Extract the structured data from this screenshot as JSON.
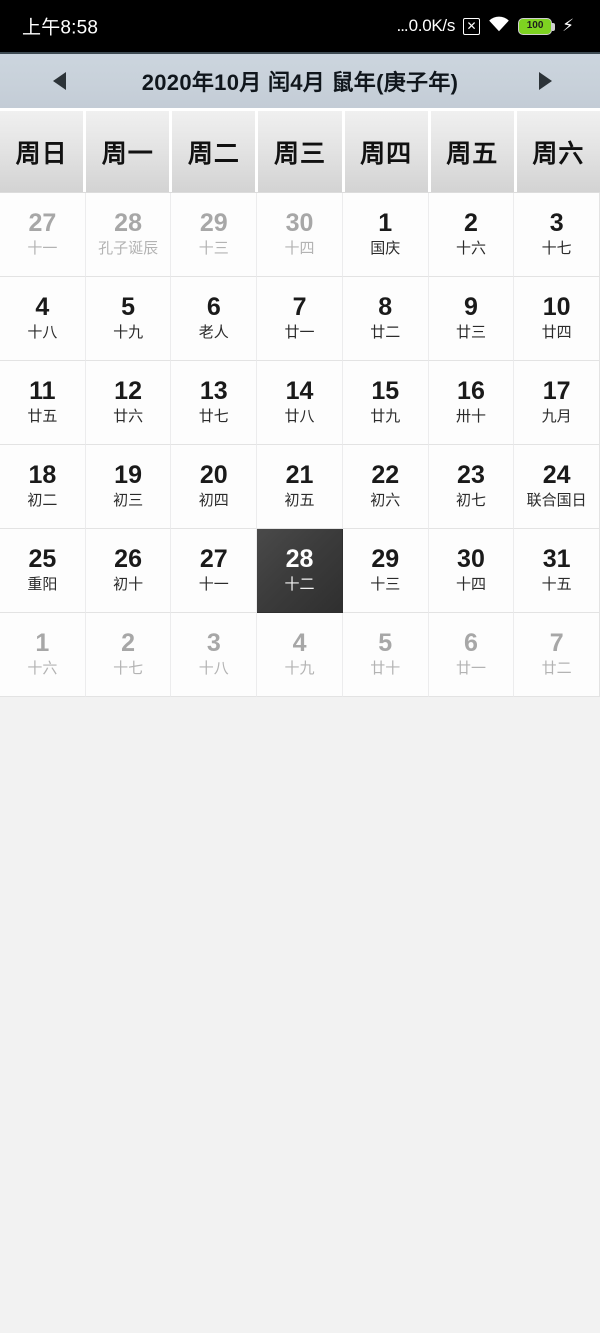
{
  "status_bar": {
    "clock": "上午8:58",
    "net_dots": "...",
    "net_speed": "0.0K/s",
    "nosim_glyph": "✕",
    "nosim_icon_name": "no-sim-icon",
    "wifi_icon_name": "wifi-icon",
    "battery_level": "100",
    "battery_color": "#7ed321",
    "charging_glyph": "⚡"
  },
  "titlebar": {
    "title": "2020年10月 闰4月 鼠年(庚子年)",
    "prev_label": "◀",
    "next_label": "▶"
  },
  "weekdays": [
    {
      "label": "周日"
    },
    {
      "label": "周一"
    },
    {
      "label": "周二"
    },
    {
      "label": "周三"
    },
    {
      "label": "周四"
    },
    {
      "label": "周五"
    },
    {
      "label": "周六"
    }
  ],
  "selected_color": "#3a3a3a",
  "weeks": [
    [
      {
        "day": "27",
        "lunar": "十一",
        "other": true,
        "selected": false
      },
      {
        "day": "28",
        "lunar": "孔子诞辰",
        "other": true,
        "selected": false
      },
      {
        "day": "29",
        "lunar": "十三",
        "other": true,
        "selected": false
      },
      {
        "day": "30",
        "lunar": "十四",
        "other": true,
        "selected": false
      },
      {
        "day": "1",
        "lunar": "国庆",
        "other": false,
        "selected": false
      },
      {
        "day": "2",
        "lunar": "十六",
        "other": false,
        "selected": false
      },
      {
        "day": "3",
        "lunar": "十七",
        "other": false,
        "selected": false
      }
    ],
    [
      {
        "day": "4",
        "lunar": "十八",
        "other": false,
        "selected": false
      },
      {
        "day": "5",
        "lunar": "十九",
        "other": false,
        "selected": false
      },
      {
        "day": "6",
        "lunar": "老人",
        "other": false,
        "selected": false
      },
      {
        "day": "7",
        "lunar": "廿一",
        "other": false,
        "selected": false
      },
      {
        "day": "8",
        "lunar": "廿二",
        "other": false,
        "selected": false
      },
      {
        "day": "9",
        "lunar": "廿三",
        "other": false,
        "selected": false
      },
      {
        "day": "10",
        "lunar": "廿四",
        "other": false,
        "selected": false
      }
    ],
    [
      {
        "day": "11",
        "lunar": "廿五",
        "other": false,
        "selected": false
      },
      {
        "day": "12",
        "lunar": "廿六",
        "other": false,
        "selected": false
      },
      {
        "day": "13",
        "lunar": "廿七",
        "other": false,
        "selected": false
      },
      {
        "day": "14",
        "lunar": "廿八",
        "other": false,
        "selected": false
      },
      {
        "day": "15",
        "lunar": "廿九",
        "other": false,
        "selected": false
      },
      {
        "day": "16",
        "lunar": "卅十",
        "other": false,
        "selected": false
      },
      {
        "day": "17",
        "lunar": "九月",
        "other": false,
        "selected": false
      }
    ],
    [
      {
        "day": "18",
        "lunar": "初二",
        "other": false,
        "selected": false
      },
      {
        "day": "19",
        "lunar": "初三",
        "other": false,
        "selected": false
      },
      {
        "day": "20",
        "lunar": "初四",
        "other": false,
        "selected": false
      },
      {
        "day": "21",
        "lunar": "初五",
        "other": false,
        "selected": false
      },
      {
        "day": "22",
        "lunar": "初六",
        "other": false,
        "selected": false
      },
      {
        "day": "23",
        "lunar": "初七",
        "other": false,
        "selected": false
      },
      {
        "day": "24",
        "lunar": "联合国日",
        "other": false,
        "selected": false
      }
    ],
    [
      {
        "day": "25",
        "lunar": "重阳",
        "other": false,
        "selected": false
      },
      {
        "day": "26",
        "lunar": "初十",
        "other": false,
        "selected": false
      },
      {
        "day": "27",
        "lunar": "十一",
        "other": false,
        "selected": false
      },
      {
        "day": "28",
        "lunar": "十二",
        "other": false,
        "selected": true
      },
      {
        "day": "29",
        "lunar": "十三",
        "other": false,
        "selected": false
      },
      {
        "day": "30",
        "lunar": "十四",
        "other": false,
        "selected": false
      },
      {
        "day": "31",
        "lunar": "十五",
        "other": false,
        "selected": false
      }
    ],
    [
      {
        "day": "1",
        "lunar": "十六",
        "other": true,
        "selected": false
      },
      {
        "day": "2",
        "lunar": "十七",
        "other": true,
        "selected": false
      },
      {
        "day": "3",
        "lunar": "十八",
        "other": true,
        "selected": false
      },
      {
        "day": "4",
        "lunar": "十九",
        "other": true,
        "selected": false
      },
      {
        "day": "5",
        "lunar": "廿十",
        "other": true,
        "selected": false
      },
      {
        "day": "6",
        "lunar": "廿一",
        "other": true,
        "selected": false
      },
      {
        "day": "7",
        "lunar": "廿二",
        "other": true,
        "selected": false
      }
    ]
  ]
}
